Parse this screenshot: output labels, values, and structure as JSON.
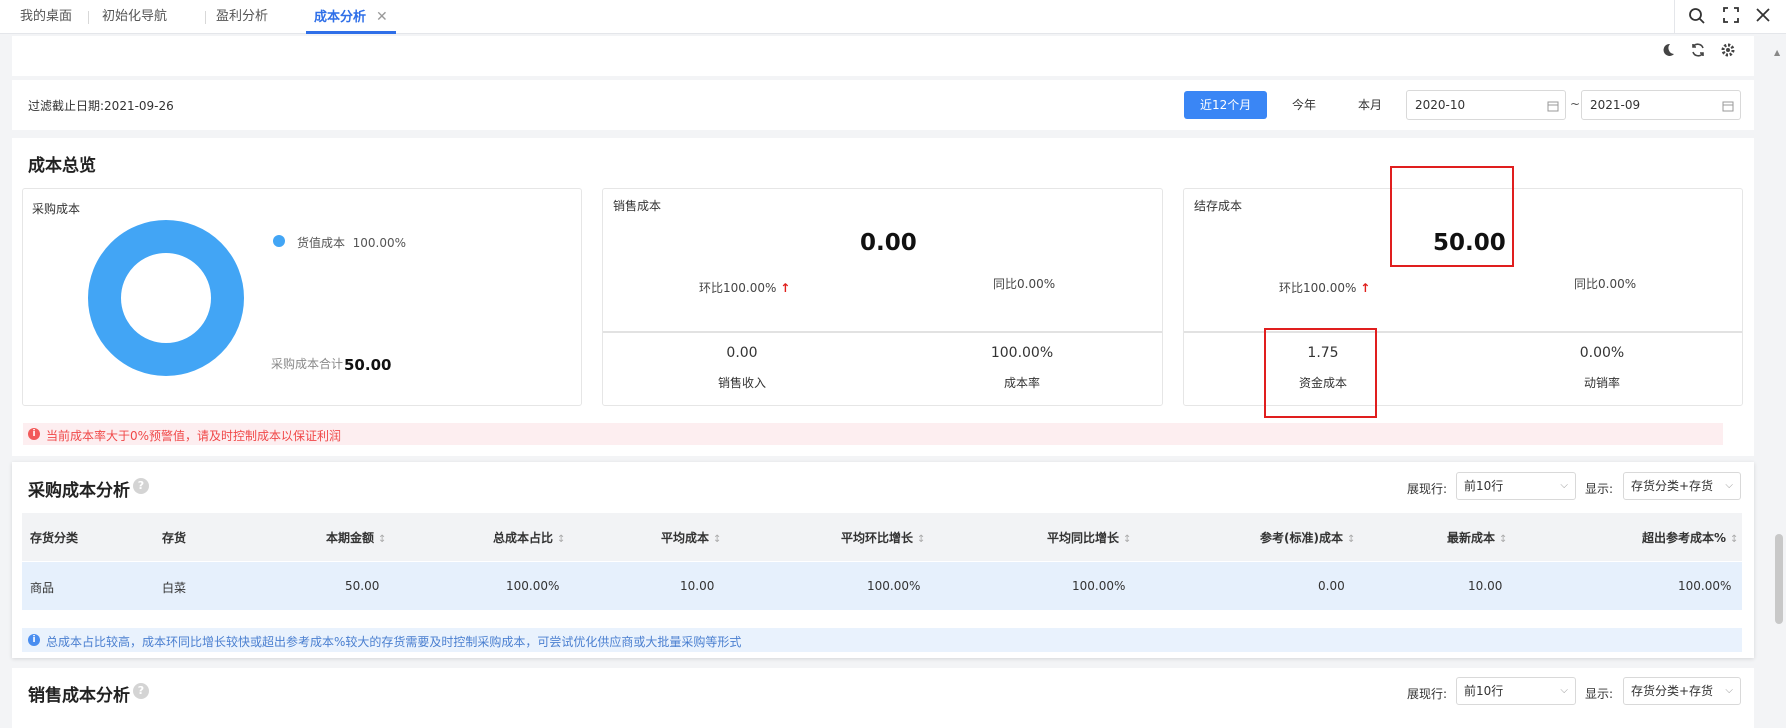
{
  "tabs": [
    {
      "label": "我的桌面"
    },
    {
      "label": "初始化导航"
    },
    {
      "label": "盈利分析"
    },
    {
      "label": "成本分析",
      "close": "✕"
    }
  ],
  "filter": {
    "cutoff_label": "过滤截止日期:2021-09-26",
    "periods": [
      "近12个月",
      "今年",
      "本月"
    ],
    "active_period": "近12个月",
    "date_from": "2020-10",
    "date_to": "2021-09",
    "tilde": "~"
  },
  "overview": {
    "title": "成本总览",
    "purchase": {
      "title": "采购成本",
      "legend": "货值成本",
      "legend_pct": "100.00%",
      "total_label": "采购成本合计",
      "total_value": "50.00",
      "chart_data": {
        "type": "pie",
        "categories": [
          "货值成本"
        ],
        "values": [
          100
        ]
      }
    },
    "sales": {
      "title": "销售成本",
      "value": "0.00",
      "mom": "环比100.00%",
      "yoy": "同比0.00%",
      "sub": [
        {
          "value": "0.00",
          "label": "销售收入"
        },
        {
          "value": "100.00%",
          "label": "成本率"
        }
      ]
    },
    "inventory": {
      "title": "结存成本",
      "value": "50.00",
      "mom": "环比100.00%",
      "yoy": "同比0.00%",
      "sub": [
        {
          "value": "1.75",
          "label": "资金成本"
        },
        {
          "value": "0.00%",
          "label": "动销率"
        }
      ]
    },
    "warning": "当前成本率大于0%预警值，请及时控制成本以保证利润"
  },
  "purchase_analysis": {
    "title": "采购成本分析",
    "rows_label": "展现行:",
    "rows_value": "前10行",
    "display_label": "显示:",
    "display_value": "存货分类+存货",
    "columns": [
      "存货分类",
      "存货",
      "本期金额",
      "总成本占比",
      "平均成本",
      "平均环比增长",
      "平均同比增长",
      "参考(标准)成本",
      "最新成本",
      "超出参考成本%"
    ],
    "rows": [
      [
        "商品",
        "白菜",
        "50.00",
        "100.00%",
        "10.00",
        "100.00%",
        "100.00%",
        "0.00",
        "10.00",
        "100.00%"
      ]
    ],
    "info": "总成本占比较高，成本环同比增长较快或超出参考成本%较大的存货需要及时控制采购成本，可尝试优化供应商或大批量采购等形式"
  },
  "sales_analysis": {
    "title": "销售成本分析",
    "rows_label": "展现行:",
    "rows_value": "前10行",
    "display_label": "显示:",
    "display_value": "存货分类+存货"
  },
  "icons": {
    "search": "search-icon",
    "fullscreen": "fullscreen-icon",
    "close": "close-icon",
    "theme": "moon-icon",
    "refresh": "refresh-icon",
    "settings": "gear-icon"
  },
  "colors": {
    "accent": "#3a86f5",
    "donut": "#42a5f5",
    "up_arrow": "#e0201c",
    "highlight_box": "#e01e1e",
    "warning_text": "#f04848"
  }
}
